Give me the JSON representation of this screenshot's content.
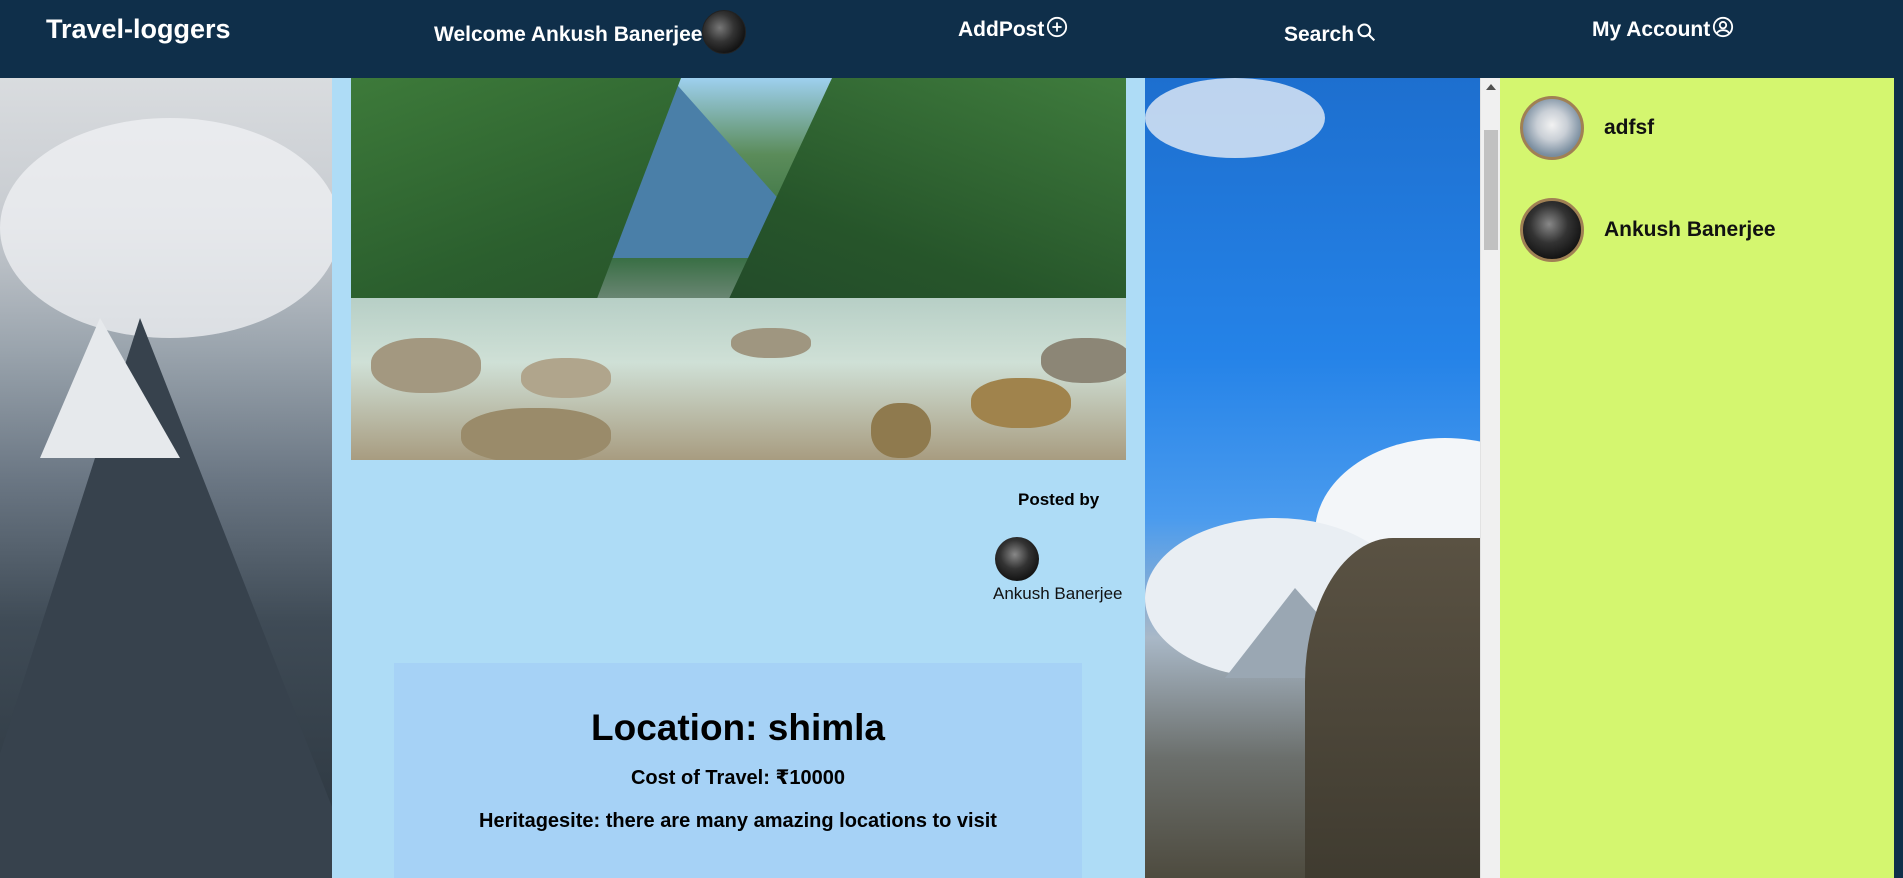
{
  "navbar": {
    "brand": "Travel-loggers",
    "welcome": "Welcome Ankush Banerjee",
    "add_post": "AddPost",
    "search": "Search",
    "account": "My Account"
  },
  "post": {
    "posted_by_label": "Posted by",
    "author": "Ankush Banerjee",
    "location": "Location: shimla",
    "cost": "Cost of Travel: ₹10000",
    "heritage": "Heritagesite: there are many amazing locations to visit"
  },
  "users": [
    {
      "name": "adfsf"
    },
    {
      "name": "Ankush Banerjee"
    }
  ],
  "colors": {
    "navbar": "#0f2f4a",
    "post_column": "#aedcf6",
    "info_card": "#a6d2f6",
    "user_panel": "#d4f66f",
    "avatar_border": "#a08054"
  },
  "icons": {
    "add_post": "plus-circle-icon",
    "search": "search-icon",
    "account": "user-circle-icon"
  }
}
